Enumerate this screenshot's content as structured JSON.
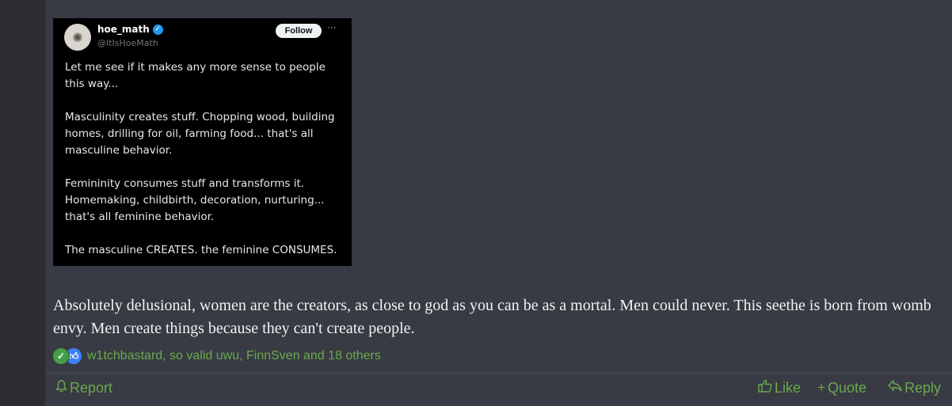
{
  "tweet": {
    "name": "hoe_math",
    "handle": "@ItIsHoeMath",
    "follow_label": "Follow",
    "more": "···",
    "paragraphs": [
      "Let me see if it makes any more sense to people this way...",
      "Masculinity creates stuff. Chopping wood, building homes, drilling for oil, farming food... that's all masculine behavior.",
      "Femininity consumes stuff and transforms it. Homemaking, childbirth, decoration, nurturing... that's all feminine behavior.",
      "The masculine CREATES. the feminine CONSUMES."
    ]
  },
  "comment": {
    "text": "Absolutely delusional, women are the creators, as close to god as you can be as a mortal. Men could never. This seethe is born from womb envy. Men create things because they can't create people."
  },
  "reactions": {
    "icons": [
      "check-reaction-icon",
      "like-reaction-icon"
    ],
    "users": "w1tchbastard, so valid uwu, FinnSven and 18 others"
  },
  "actions": {
    "report": "Report",
    "like": "Like",
    "quote": "Quote",
    "reply": "Reply"
  },
  "colors": {
    "page_background": "#2b2d33",
    "post_background": "#383b43",
    "accent_green": "#6aa84f",
    "verified_blue": "#1d9bf0"
  }
}
